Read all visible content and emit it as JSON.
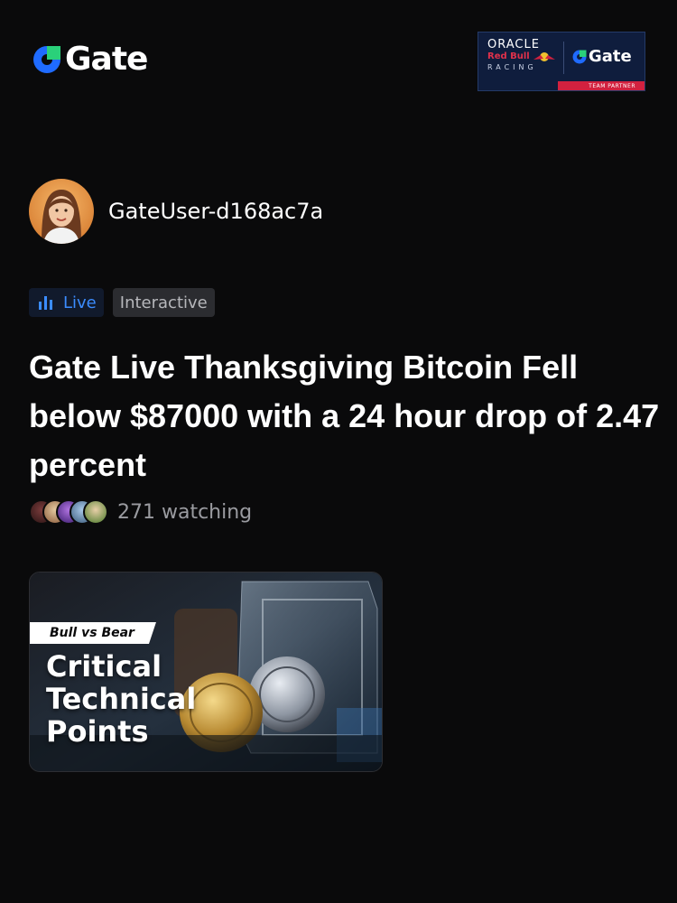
{
  "brand": {
    "name": "Gate",
    "accent": "#1f6bff",
    "green": "#2ad17a"
  },
  "partner": {
    "oracle": "ORACLE",
    "redbull": "Red Bull",
    "racing": "RACING",
    "gate": "Gate",
    "team_partner": "TEAM PARTNER"
  },
  "user": {
    "name": "GateUser-d168ac7a"
  },
  "tags": {
    "live": "Live",
    "interactive": "Interactive"
  },
  "post": {
    "title": "Gate Live Thanksgiving Bitcoin Fell below $87000 with a 24 hour drop of 2.47 percent",
    "watching": "271 watching"
  },
  "thumbnail": {
    "tag": "Bull vs Bear",
    "headline_lines": [
      "Critical",
      "Technical",
      "Points"
    ]
  },
  "colors": {
    "live": "#3b8cff",
    "background": "#0a0a0b",
    "muted": "#9a9ba0"
  }
}
